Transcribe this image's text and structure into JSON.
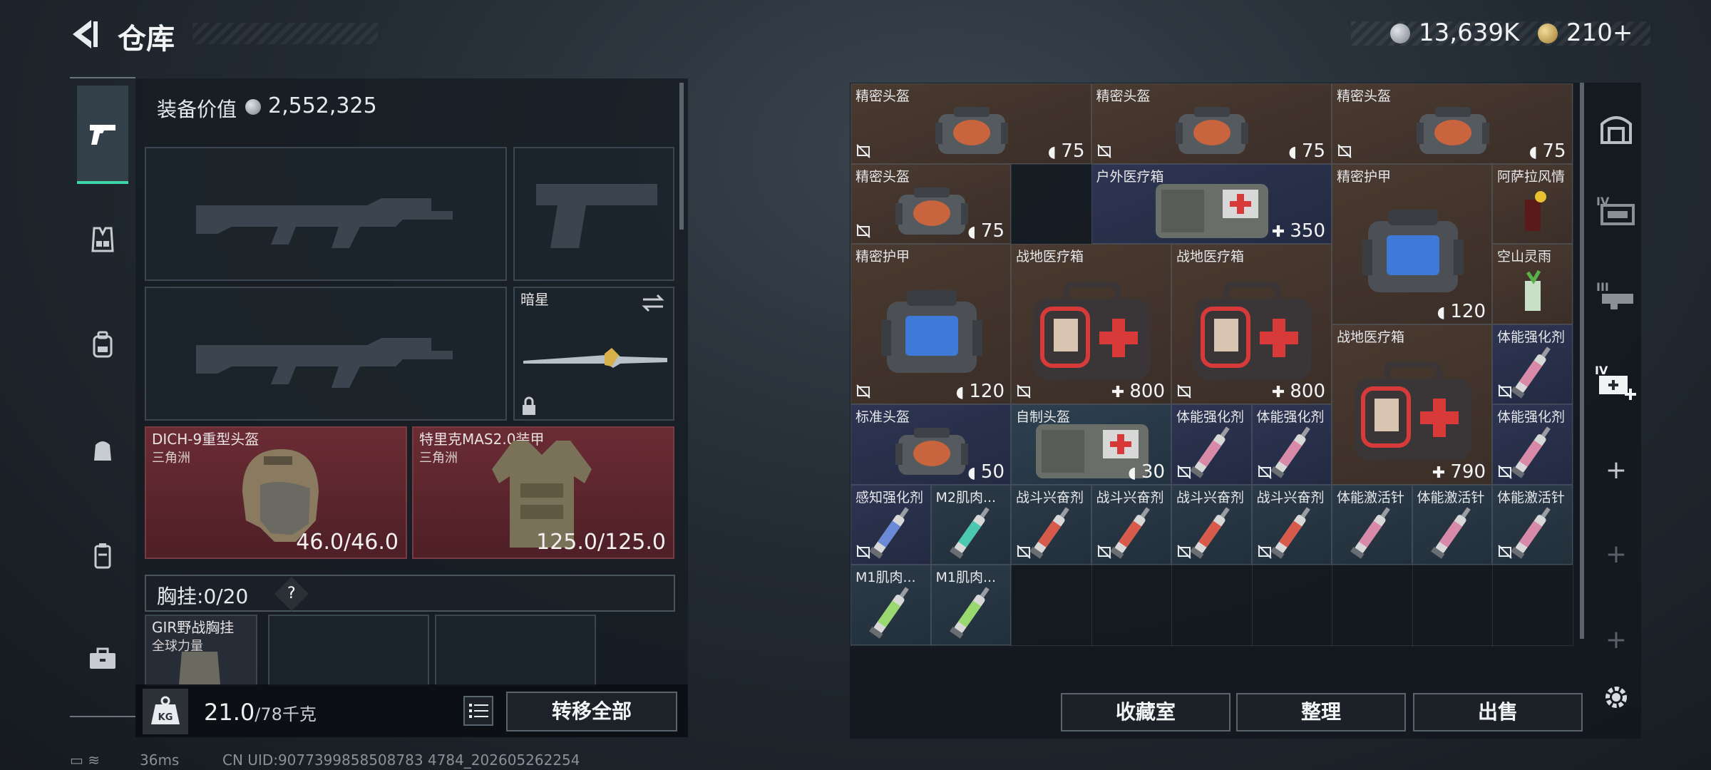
{
  "header": {
    "title": "仓库",
    "currency_silver": "13,639K",
    "currency_gold": "210+"
  },
  "loadout": {
    "equip_value_label": "装备价值",
    "equip_value": "2,552,325",
    "sidearm_name": "暗星",
    "helmet": {
      "name": "DICH-9重型头盔",
      "faction": "三角洲",
      "durability": "46.0/46.0"
    },
    "armor": {
      "name": "特里克MAS2.0装甲",
      "faction": "三角洲",
      "durability": "125.0/125.0"
    },
    "vest_label": "胸挂:",
    "vest_count": "0/20",
    "vest_help": "?",
    "vest_item": {
      "name": "GIR野战胸挂",
      "faction": "全球力量"
    },
    "weight_value": "21.0",
    "weight_cap": "/78千克",
    "transfer_all": "转移全部"
  },
  "inventory": {
    "items": [
      {
        "id": "i1",
        "name": "精密头盔",
        "value": "75",
        "bg": "brown",
        "kind": "helmet",
        "nosell": true
      },
      {
        "id": "i2",
        "name": "精密头盔",
        "value": "75",
        "bg": "brown",
        "kind": "helmet",
        "nosell": true
      },
      {
        "id": "i3",
        "name": "精密头盔",
        "value": "75",
        "bg": "brown",
        "kind": "helmet",
        "nosell": true
      },
      {
        "id": "i4",
        "name": "精密头盔",
        "value": "75",
        "bg": "brown",
        "kind": "helmet",
        "nosell": true
      },
      {
        "id": "i5",
        "name": "户外医疗箱",
        "value": "350",
        "bg": "navy",
        "kind": "medpouch",
        "nosell": false
      },
      {
        "id": "i6",
        "name": "精密护甲",
        "value": "120",
        "bg": "brown",
        "kind": "armorbag",
        "nosell": false
      },
      {
        "id": "i7",
        "name": "阿萨拉风情",
        "value": "",
        "bg": "brown",
        "kind": "drink",
        "nosell": false
      },
      {
        "id": "i8",
        "name": "精密护甲",
        "value": "120",
        "bg": "brown",
        "kind": "armorbag",
        "nosell": true
      },
      {
        "id": "i9",
        "name": "战地医疗箱",
        "value": "800",
        "bg": "brown",
        "kind": "firstaid",
        "nosell": true
      },
      {
        "id": "i10",
        "name": "战地医疗箱",
        "value": "800",
        "bg": "brown",
        "kind": "firstaid",
        "nosell": true
      },
      {
        "id": "i11",
        "name": "空山灵雨",
        "value": "",
        "bg": "brown",
        "kind": "drink2",
        "nosell": false
      },
      {
        "id": "i12",
        "name": "战地医疗箱",
        "value": "790",
        "bg": "brown",
        "kind": "firstaid",
        "nosell": false
      },
      {
        "id": "i13",
        "name": "体能强化剂",
        "value": "",
        "bg": "navy",
        "kind": "syringe-pink",
        "nosell": true
      },
      {
        "id": "i14",
        "name": "标准头盔",
        "value": "50",
        "bg": "navy",
        "kind": "helmet",
        "nosell": false
      },
      {
        "id": "i15",
        "name": "自制头盔",
        "value": "30",
        "bg": "blue",
        "kind": "medpouch",
        "nosell": false
      },
      {
        "id": "i16",
        "name": "体能强化剂",
        "value": "",
        "bg": "navy",
        "kind": "syringe-pink",
        "nosell": true
      },
      {
        "id": "i17",
        "name": "体能强化剂",
        "value": "",
        "bg": "navy",
        "kind": "syringe-pink",
        "nosell": true
      },
      {
        "id": "i18",
        "name": "体能强化剂",
        "value": "",
        "bg": "navy",
        "kind": "syringe-pink",
        "nosell": true
      },
      {
        "id": "i19",
        "name": "感知强化剂",
        "value": "",
        "bg": "navy",
        "kind": "syringe-blue",
        "nosell": true
      },
      {
        "id": "i20",
        "name": "M2肌肉...",
        "value": "",
        "bg": "slate",
        "kind": "syringe-teal",
        "nosell": false
      },
      {
        "id": "i21",
        "name": "战斗兴奋剂",
        "value": "",
        "bg": "slate",
        "kind": "syringe-red",
        "nosell": true
      },
      {
        "id": "i22",
        "name": "战斗兴奋剂",
        "value": "",
        "bg": "slate",
        "kind": "syringe-red",
        "nosell": true
      },
      {
        "id": "i23",
        "name": "战斗兴奋剂",
        "value": "",
        "bg": "slate",
        "kind": "syringe-red",
        "nosell": true
      },
      {
        "id": "i24",
        "name": "战斗兴奋剂",
        "value": "",
        "bg": "slate",
        "kind": "syringe-red",
        "nosell": true
      },
      {
        "id": "i25",
        "name": "体能激活针",
        "value": "",
        "bg": "slate",
        "kind": "syringe-pink",
        "nosell": false
      },
      {
        "id": "i26",
        "name": "体能激活针",
        "value": "",
        "bg": "slate",
        "kind": "syringe-pink",
        "nosell": false
      },
      {
        "id": "i27",
        "name": "体能激活针",
        "value": "",
        "bg": "slate",
        "kind": "syringe-pink",
        "nosell": true
      },
      {
        "id": "i28",
        "name": "M1肌肉...",
        "value": "",
        "bg": "slate",
        "kind": "syringe-green",
        "nosell": false
      },
      {
        "id": "i29",
        "name": "M1肌肉...",
        "value": "",
        "bg": "slate",
        "kind": "syringe-green",
        "nosell": false
      }
    ],
    "buttons": {
      "collection": "收藏室",
      "organize": "整理",
      "sell": "出售"
    }
  },
  "footer": {
    "ping": "36ms",
    "uid": "CN UID:9077399858508783 4784_202605262254"
  },
  "colors": {
    "accent": "#3dd6a8",
    "red_slot": "#6b2c34",
    "panel": "#161c22"
  },
  "icons": [
    "back-arrow-icon",
    "pistol-icon",
    "vest-icon",
    "backpack-icon",
    "pouch-icon",
    "case-icon",
    "toolbox-icon",
    "kg-weight-icon",
    "list-icon",
    "swap-icon",
    "lock-icon",
    "shield-icon",
    "plus-icon",
    "nosell-icon",
    "gear-icon",
    "vault-icon",
    "storage-iv-icon",
    "storage-iii-icon",
    "storage-iv-plus-icon"
  ]
}
